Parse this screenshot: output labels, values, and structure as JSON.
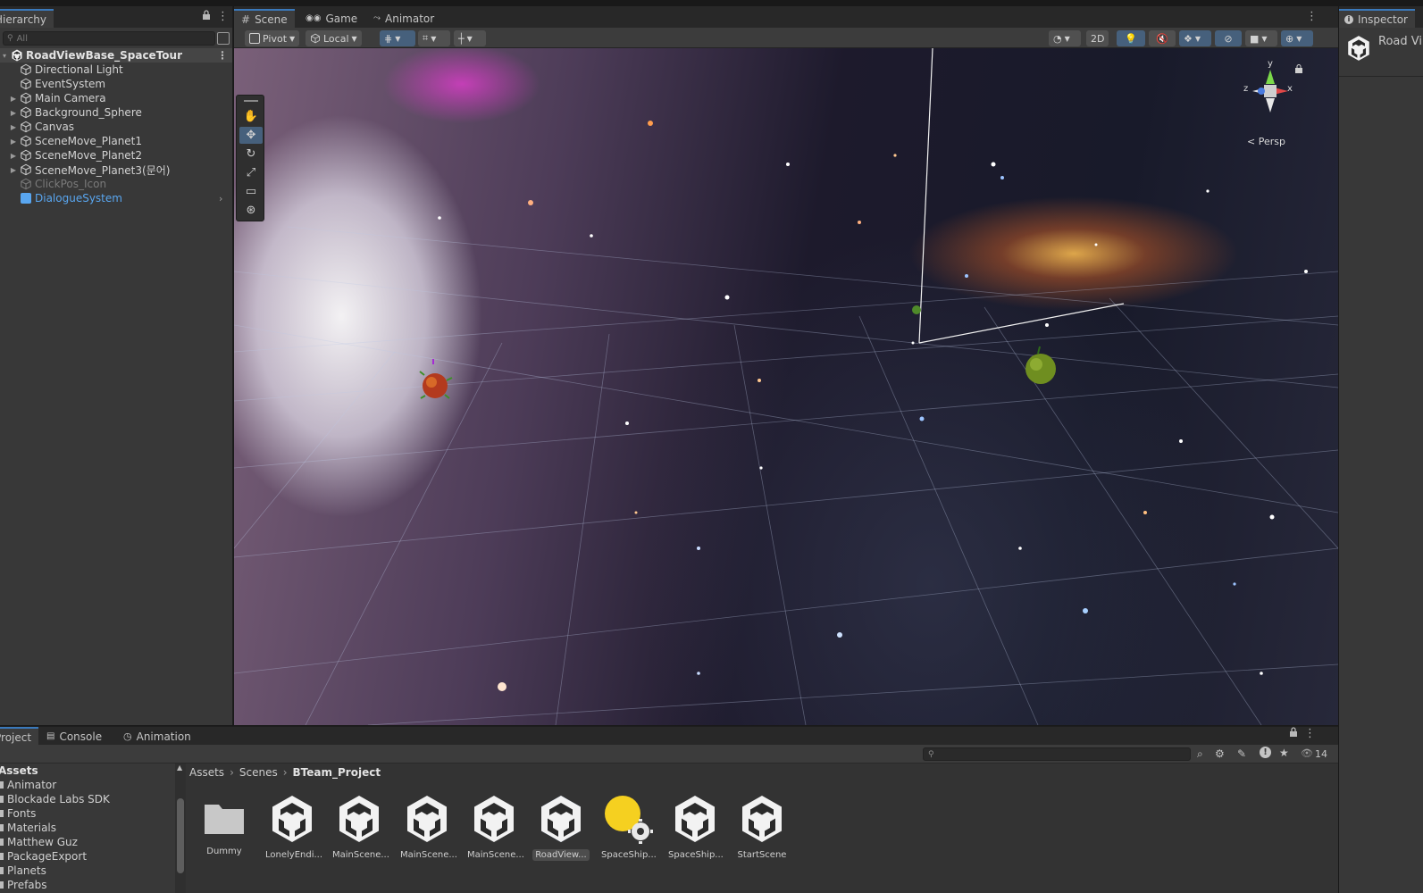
{
  "hierarchy": {
    "tab_label": "Hierarchy",
    "search_placeholder": "All",
    "root": "RoadViewBase_SpaceTour",
    "items": [
      {
        "label": "Directional Light"
      },
      {
        "label": "EventSystem"
      },
      {
        "label": "Main Camera"
      },
      {
        "label": "Background_Sphere"
      },
      {
        "label": "Canvas"
      },
      {
        "label": "SceneMove_Planet1"
      },
      {
        "label": "SceneMove_Planet2"
      },
      {
        "label": "SceneMove_Planet3(문어)"
      },
      {
        "label": "ClickPos_Icon"
      },
      {
        "label": "DialogueSystem"
      }
    ]
  },
  "scene": {
    "tabs": [
      {
        "label": "Scene"
      },
      {
        "label": "Game"
      },
      {
        "label": "Animator"
      }
    ],
    "toolbar": {
      "pivot": "Pivot",
      "local": "Local",
      "mode_2d": "2D"
    },
    "gizmo": {
      "y": "y",
      "x": "x",
      "z": "z",
      "persp": "< Persp"
    }
  },
  "inspector": {
    "tab_label": "Inspector",
    "object_name": "Road Vi"
  },
  "project": {
    "tabs": [
      {
        "label": "Project"
      },
      {
        "label": "Console"
      },
      {
        "label": "Animation"
      }
    ],
    "hidden_count": "14",
    "tree": [
      {
        "label": "Assets"
      },
      {
        "label": "Animator"
      },
      {
        "label": "Blockade Labs SDK"
      },
      {
        "label": "Fonts"
      },
      {
        "label": "Materials"
      },
      {
        "label": "Matthew Guz"
      },
      {
        "label": "PackageExport"
      },
      {
        "label": "Planets"
      },
      {
        "label": "Prefabs"
      }
    ],
    "breadcrumb": [
      "Assets",
      "Scenes",
      "BTeam_Project"
    ],
    "assets": [
      {
        "label": "Dummy",
        "icon": "folder-icon"
      },
      {
        "label": "LonelyEndi...",
        "icon": "unity-scene-icon"
      },
      {
        "label": "MainScene...",
        "icon": "unity-scene-icon"
      },
      {
        "label": "MainScene...",
        "icon": "unity-scene-icon"
      },
      {
        "label": "MainScene...",
        "icon": "unity-scene-icon"
      },
      {
        "label": "RoadView...",
        "icon": "unity-scene-icon"
      },
      {
        "label": "SpaceShip...",
        "icon": "lighting-settings-icon"
      },
      {
        "label": "SpaceShip...",
        "icon": "unity-scene-icon"
      },
      {
        "label": "StartScene",
        "icon": "unity-scene-icon"
      }
    ]
  },
  "colors": {
    "selection_blue": "#3a79bb",
    "prefab_blue": "#59a6f0",
    "panel_bg": "#383838"
  }
}
